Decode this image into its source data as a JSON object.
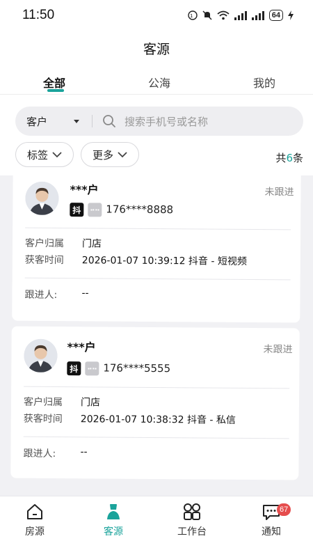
{
  "status_bar": {
    "time": "11:50",
    "battery": "64"
  },
  "header": {
    "title": "客源"
  },
  "tabs": [
    {
      "label": "全部",
      "active": true
    },
    {
      "label": "公海",
      "active": false
    },
    {
      "label": "我的",
      "active": false
    }
  ],
  "search": {
    "type_label": "客户",
    "placeholder": "搜索手机号或名称"
  },
  "filters": {
    "tag_label": "标签",
    "more_label": "更多",
    "count_prefix": "共",
    "count_value": "6",
    "count_suffix": "条"
  },
  "customers": [
    {
      "name": "***户",
      "status": "未跟进",
      "source_badge": "抖",
      "phone": "176****8888",
      "owner_label": "客户归属",
      "owner_value": "门店",
      "time_label": "获客时间",
      "time_value": "2026-01-07 10:39:12 抖音 - 短视频",
      "follower_label": "跟进人:",
      "follower_value": "--"
    },
    {
      "name": "***户",
      "status": "未跟进",
      "source_badge": "抖",
      "phone": "176****5555",
      "owner_label": "客户归属",
      "owner_value": "门店",
      "time_label": "获客时间",
      "time_value": "2026-01-07 10:38:32 抖音 - 私信",
      "follower_label": "跟进人:",
      "follower_value": "--"
    }
  ],
  "tabbar": [
    {
      "label": "房源",
      "icon": "home-icon"
    },
    {
      "label": "客源",
      "icon": "person-icon",
      "active": true
    },
    {
      "label": "工作台",
      "icon": "grid-icon"
    },
    {
      "label": "通知",
      "icon": "chat-icon",
      "badge": "67"
    }
  ],
  "colors": {
    "accent": "#1aa39b",
    "badge": "#e54d4d"
  }
}
